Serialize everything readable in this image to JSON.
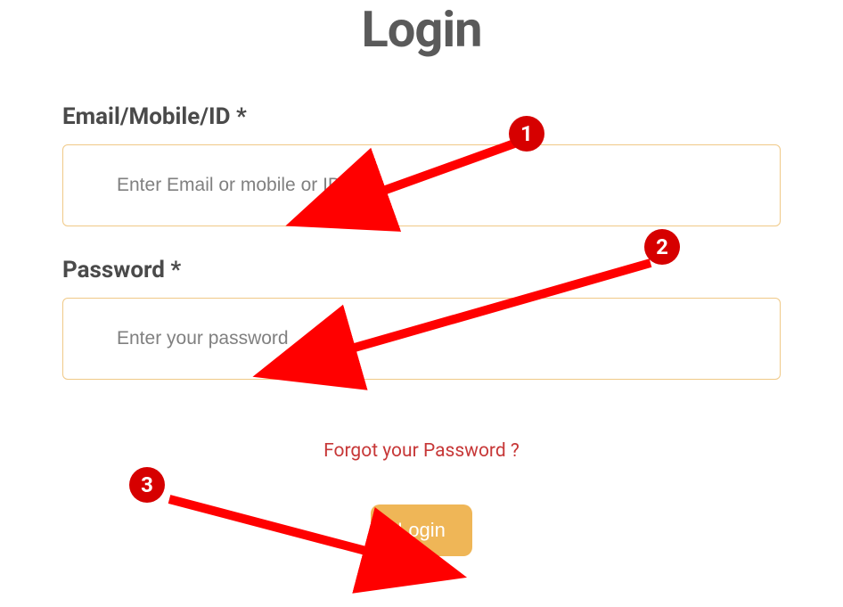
{
  "page": {
    "title": "Login"
  },
  "fields": {
    "identifier": {
      "label": "Email/Mobile/ID *",
      "placeholder": "Enter Email or mobile or ID",
      "value": ""
    },
    "password": {
      "label": "Password *",
      "placeholder": "Enter your password",
      "value": ""
    }
  },
  "links": {
    "forgot": "Forgot your Password ?"
  },
  "buttons": {
    "login": "Login"
  },
  "annotations": {
    "badge1": "1",
    "badge2": "2",
    "badge3": "3"
  }
}
